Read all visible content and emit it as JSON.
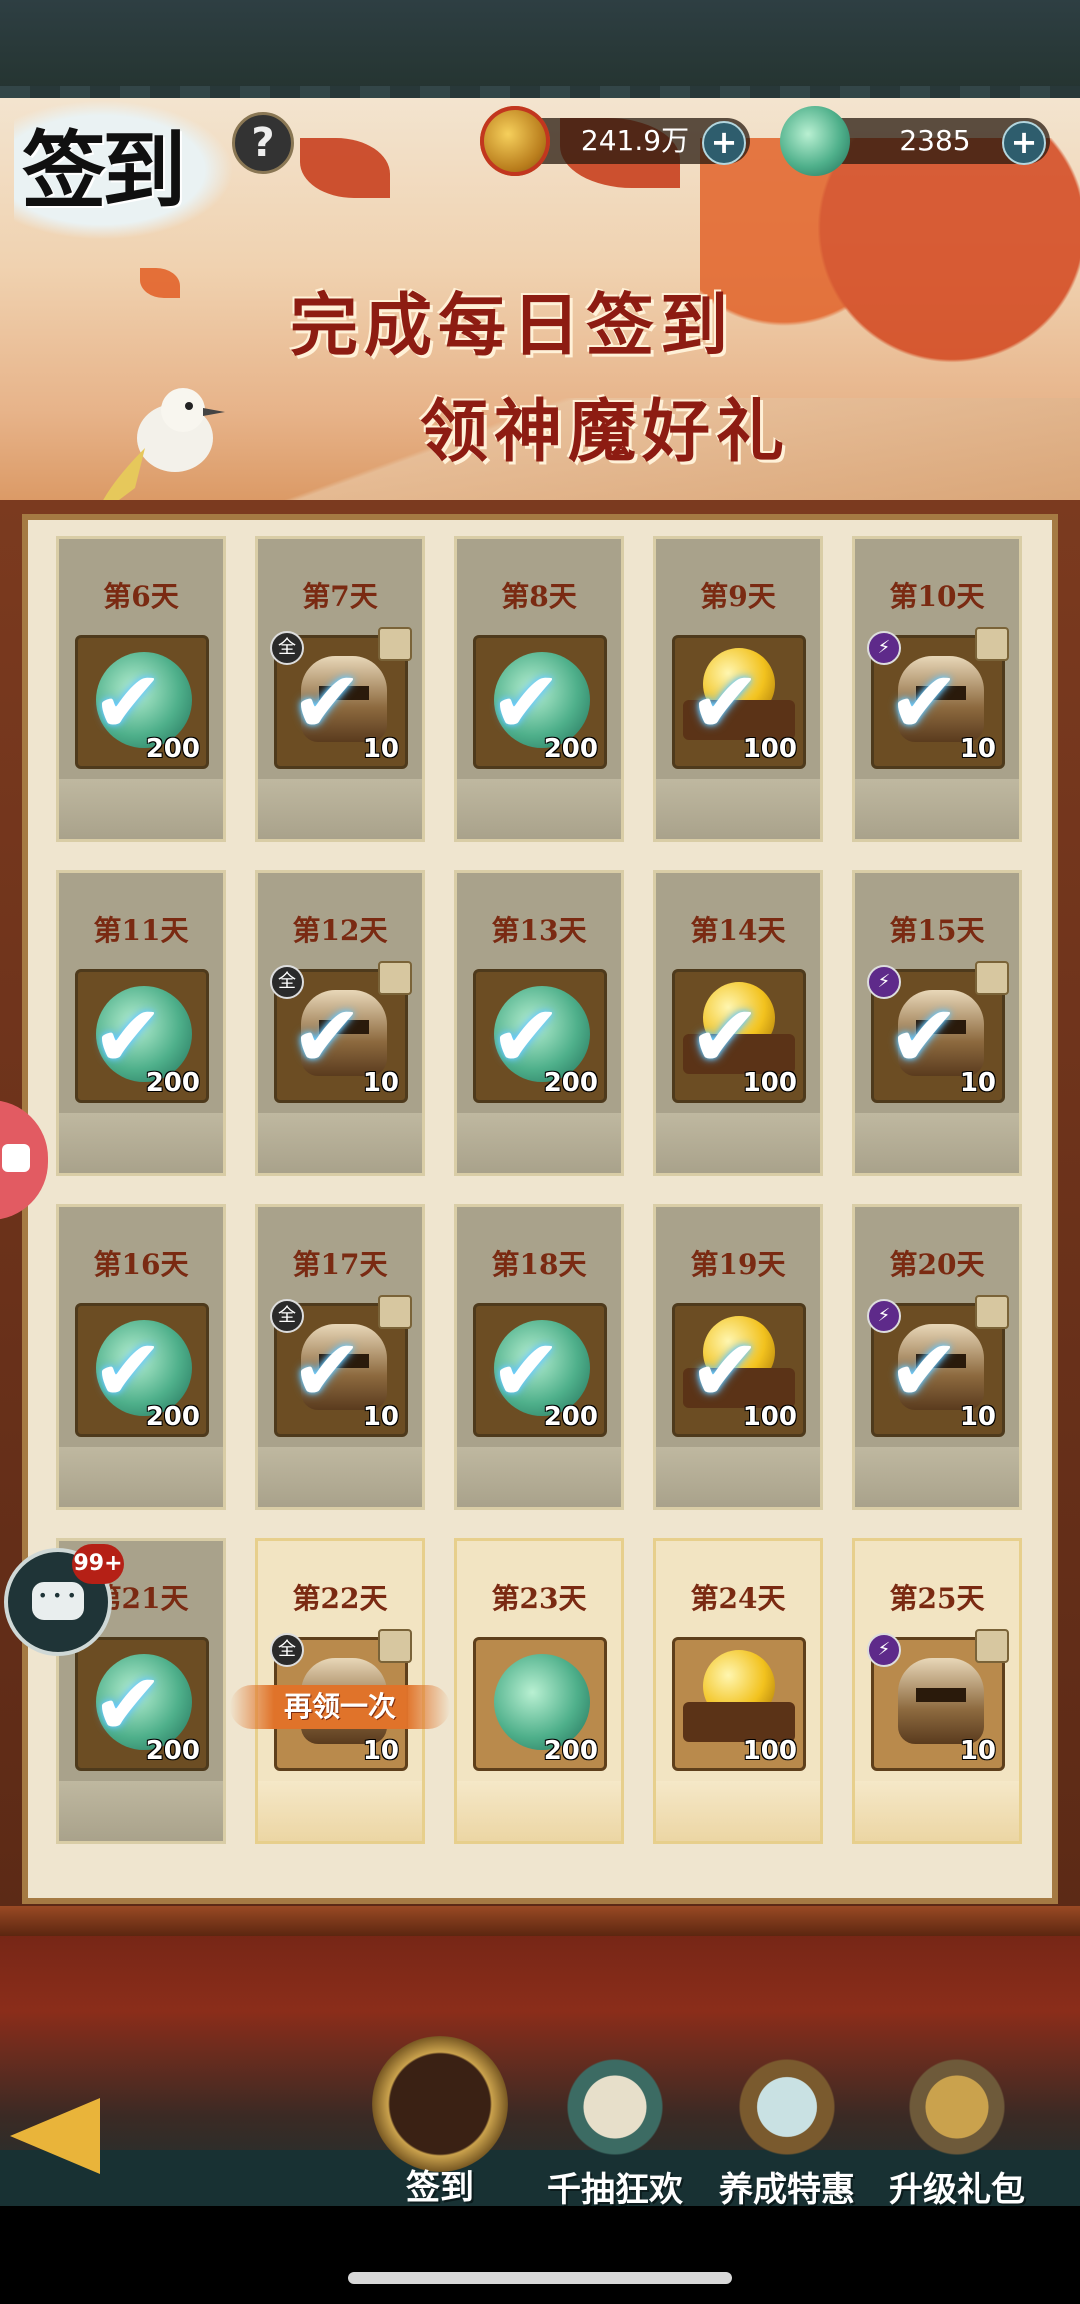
{
  "header": {
    "title": "签到",
    "help_icon": "?"
  },
  "currencies": [
    {
      "icon": "coin-icon",
      "value": "241.9万"
    },
    {
      "icon": "jade-icon",
      "value": "2385"
    }
  ],
  "banner": {
    "line1": "完成每日签到",
    "line2": "领神魔好礼"
  },
  "days": [
    {
      "label": "第6天",
      "item": "jade",
      "qty": "200",
      "claimed": true
    },
    {
      "label": "第7天",
      "item": "helm",
      "qty": "10",
      "claimed": true,
      "tag": "全"
    },
    {
      "label": "第8天",
      "item": "jade",
      "qty": "200",
      "claimed": true
    },
    {
      "label": "第9天",
      "item": "orb",
      "qty": "100",
      "claimed": true
    },
    {
      "label": "第10天",
      "item": "helm",
      "qty": "10",
      "claimed": true,
      "tag": "⚡"
    },
    {
      "label": "第11天",
      "item": "jade",
      "qty": "200",
      "claimed": true
    },
    {
      "label": "第12天",
      "item": "helm",
      "qty": "10",
      "claimed": true,
      "tag": "全"
    },
    {
      "label": "第13天",
      "item": "jade",
      "qty": "200",
      "claimed": true
    },
    {
      "label": "第14天",
      "item": "orb",
      "qty": "100",
      "claimed": true
    },
    {
      "label": "第15天",
      "item": "helm",
      "qty": "10",
      "claimed": true,
      "tag": "⚡"
    },
    {
      "label": "第16天",
      "item": "jade",
      "qty": "200",
      "claimed": true
    },
    {
      "label": "第17天",
      "item": "helm",
      "qty": "10",
      "claimed": true,
      "tag": "全"
    },
    {
      "label": "第18天",
      "item": "jade",
      "qty": "200",
      "claimed": true
    },
    {
      "label": "第19天",
      "item": "orb",
      "qty": "100",
      "claimed": true
    },
    {
      "label": "第20天",
      "item": "helm",
      "qty": "10",
      "claimed": true,
      "tag": "⚡"
    },
    {
      "label": "第21天",
      "item": "jade",
      "qty": "200",
      "claimed": true
    },
    {
      "label": "第22天",
      "item": "helm",
      "qty": "10",
      "claimed": false,
      "tag": "全",
      "action": "再领一次"
    },
    {
      "label": "第23天",
      "item": "jade",
      "qty": "200",
      "claimed": false
    },
    {
      "label": "第24天",
      "item": "orb",
      "qty": "100",
      "claimed": false
    },
    {
      "label": "第25天",
      "item": "helm",
      "qty": "10",
      "claimed": false,
      "tag": "⚡"
    }
  ],
  "badges": {
    "chat_count": "99+"
  },
  "tabs": [
    {
      "label": "签到",
      "icon": "signin-icon",
      "active": true
    },
    {
      "label": "千抽狂欢",
      "icon": "scroll-chest-icon"
    },
    {
      "label": "养成特惠",
      "icon": "treasure-chest-icon"
    },
    {
      "label": "升级礼包",
      "icon": "gift-cauldron-icon"
    }
  ]
}
